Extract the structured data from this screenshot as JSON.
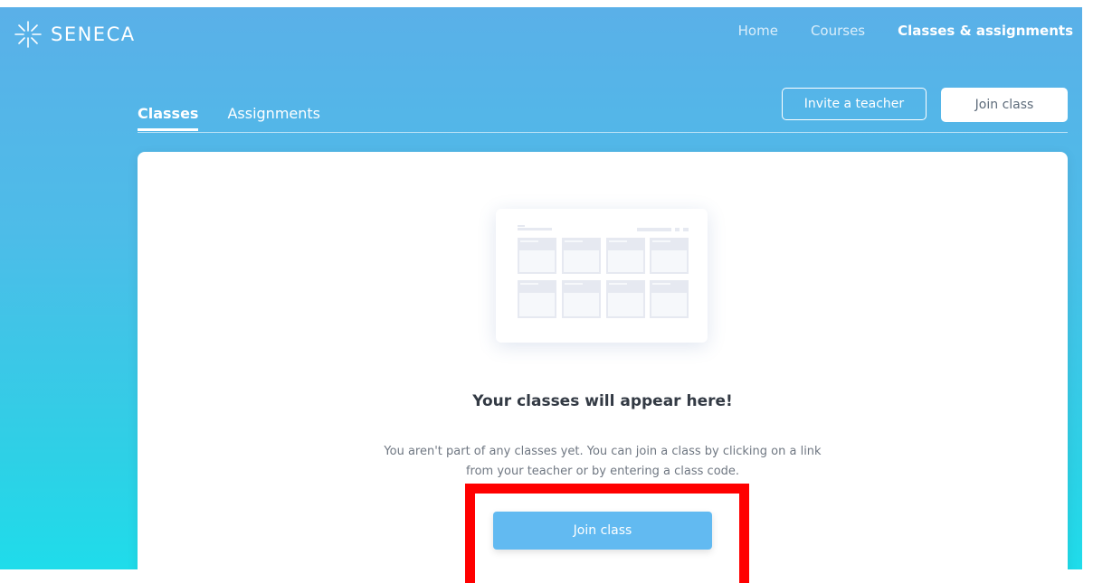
{
  "brand": {
    "name": "SENECA",
    "logo_icon": "seneca-spark-icon"
  },
  "nav": {
    "items": [
      {
        "label": "Home",
        "active": false
      },
      {
        "label": "Courses",
        "active": false
      },
      {
        "label": "Classes & assignments",
        "active": true
      }
    ]
  },
  "tabs": [
    {
      "label": "Classes",
      "active": true
    },
    {
      "label": "Assignments",
      "active": false
    }
  ],
  "actions": {
    "invite_teacher": "Invite a teacher",
    "join_class": "Join class"
  },
  "empty_state": {
    "title": "Your classes will appear here!",
    "description": "You aren't part of any classes yet. You can join a class by clicking on a link from your teacher or by entering a class code.",
    "button": "Join class"
  },
  "colors": {
    "gradient_top": "#5ab0e8",
    "gradient_bottom": "#1fdcea",
    "primary_button": "#62baf1",
    "highlight": "#ff0000"
  }
}
